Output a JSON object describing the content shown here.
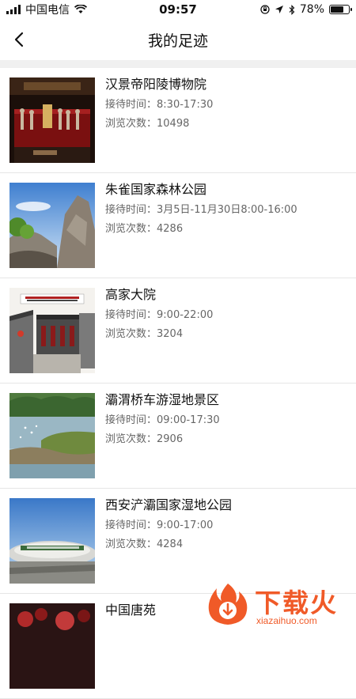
{
  "status_bar": {
    "carrier": "中国电信",
    "time": "09:57",
    "battery_percent": "78%",
    "battery_level": 0.78
  },
  "nav": {
    "title": "我的足迹"
  },
  "labels": {
    "reception": "接待时间：",
    "views": "浏览次数："
  },
  "items": [
    {
      "name": "汉景帝阳陵博物院",
      "time": "8:30-17:30",
      "views": "10498",
      "image": "museum"
    },
    {
      "name": "朱雀国家森林公园",
      "time": "3月5日-11月30日8:00-16:00",
      "views": "4286",
      "image": "forest"
    },
    {
      "name": "高家大院",
      "time": "9:00-22:00",
      "views": "3204",
      "image": "courtyard"
    },
    {
      "name": "灞渭桥车游湿地景区",
      "time": "09:00-17:30",
      "views": "2906",
      "image": "wetland"
    },
    {
      "name": "西安浐灞国家湿地公园",
      "time": "9:00-17:00",
      "views": "4284",
      "image": "park"
    },
    {
      "name": "中国唐苑",
      "time": "",
      "views": "",
      "image": "garden"
    }
  ],
  "watermark": {
    "brand": "下载火",
    "domain": "xiazaihuo.com"
  }
}
